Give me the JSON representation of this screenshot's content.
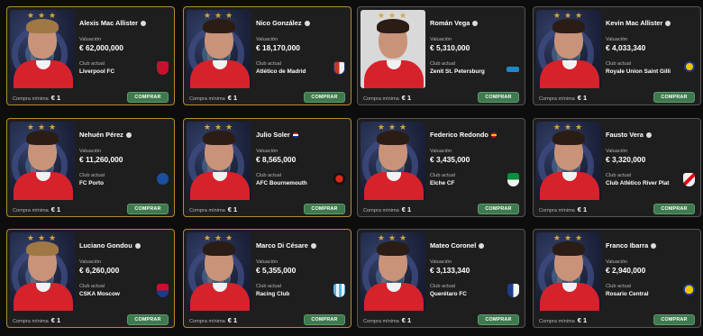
{
  "labels": {
    "valuation": "Valuación",
    "club": "Club actual",
    "min_purchase": "Compra mínima",
    "min_value": "€ 1",
    "buy": "COMPRAR"
  },
  "players": [
    {
      "name": "Alexis Mac Allister",
      "value": "€ 62,000,000",
      "club": "Liverpool FC",
      "crest_color": "#c8102e",
      "flag": "info",
      "hair": "blond"
    },
    {
      "name": "Nico González",
      "value": "€ 18,170,000",
      "club": "Atlético de Madrid",
      "crest_color": "#cb3524",
      "flag": "info",
      "hair": "dark"
    },
    {
      "name": "Román Vega",
      "value": "€ 5,310,000",
      "club": "Zenit St. Petersburg",
      "crest_color": "#1e88c9",
      "flag": "info",
      "hair": "dark"
    },
    {
      "name": "Kevin Mac Allister",
      "value": "€ 4,033,340",
      "club": "Royale Union Saint Gilli",
      "crest_color": "#f2c200",
      "flag": "info",
      "hair": "dark"
    },
    {
      "name": "Nehuén Pérez",
      "value": "€ 11,260,000",
      "club": "FC Porto",
      "crest_color": "#1b4fa0",
      "flag": "info",
      "hair": "dark"
    },
    {
      "name": "Julio Soler",
      "value": "€ 8,565,000",
      "club": "AFC Bournemouth",
      "crest_color": "#da291c",
      "flag": "py",
      "hair": "dark"
    },
    {
      "name": "Federico Redondo",
      "value": "€ 3,435,000",
      "club": "Elche CF",
      "crest_color": "#0a8f3c",
      "flag": "es",
      "hair": "dark"
    },
    {
      "name": "Fausto Vera",
      "value": "€ 3,320,000",
      "club": "Club Atlético River Plat",
      "crest_color": "#e30613",
      "flag": "info",
      "hair": "dark"
    },
    {
      "name": "Luciano Gondou",
      "value": "€ 6,260,000",
      "club": "CSKA Moscow",
      "crest_color": "#c8102e",
      "flag": "info",
      "hair": "blond"
    },
    {
      "name": "Marco Di Césare",
      "value": "€ 5,355,000",
      "club": "Racing Club",
      "crest_color": "#5ab4e5",
      "flag": "info",
      "hair": "dark"
    },
    {
      "name": "Mateo Coronel",
      "value": "€ 3,133,340",
      "club": "Querétaro FC",
      "crest_color": "#1d3c8c",
      "flag": "info",
      "hair": "dark"
    },
    {
      "name": "Franco Ibarra",
      "value": "€ 2,940,000",
      "club": "Rosario Central",
      "crest_color": "#f5c400",
      "flag": "info",
      "hair": "dark"
    }
  ]
}
